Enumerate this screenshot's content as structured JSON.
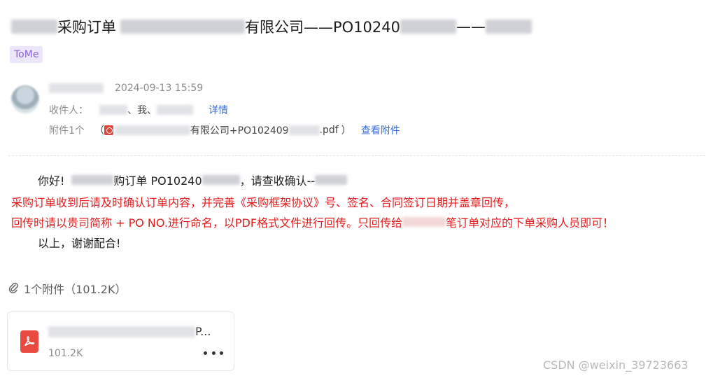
{
  "email": {
    "subject": {
      "part1": "采购订单",
      "part2": "有限公司——PO10240",
      "part3": "——"
    },
    "tag": "ToMe",
    "sent_time": "2024-09-13 15:59",
    "recipients_label": "收件人：",
    "recipients_text": "、我、",
    "details_link": "详情",
    "attachment_label": "附件1个",
    "attachment_inline_open": "（",
    "attachment_inline_name": "有限公司+PO102409",
    "attachment_inline_ext": ".pdf",
    "attachment_inline_close": "）",
    "view_attachment_link": "查看附件"
  },
  "body": {
    "line1_greeting": "你好!",
    "line1_mid": "购订单 PO10240",
    "line1_end": "，请查收确认--",
    "line2": "采购订单收到后请及时确认订单内容，并完善《采购框架协议》号、签名、合同签订日期并盖章回传，",
    "line3_a": "回传时请以贵司简称 + PO NO.进行命名，以PDF格式文件进行回传。只回传给",
    "line3_b": "笔订单对应的下单采购人员即可！",
    "line4": "以上，谢谢配合!"
  },
  "attachments": {
    "header": "1个附件（101.2K）",
    "card": {
      "name_tail": "P...",
      "size": "101.2K"
    }
  },
  "watermark": "CSDN @weixin_39723663",
  "colors": {
    "red_text": "#e21b1b",
    "link": "#3b6fd8",
    "tag_bg": "#ece6fb",
    "tag_fg": "#8a63d2",
    "pdf_red": "#e84a3d"
  }
}
